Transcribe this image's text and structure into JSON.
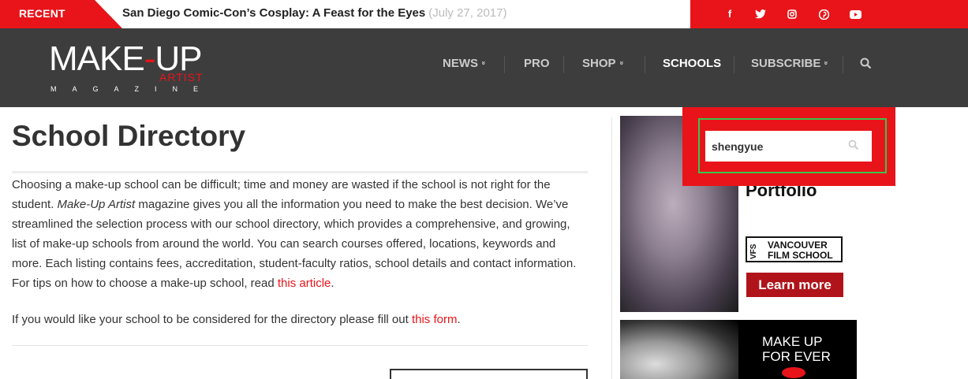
{
  "topbar": {
    "recent_label": "RECENT",
    "headline": "San Diego Comic-Con’s Cosplay: A Feast for the Eyes",
    "headline_date": "(July 27, 2017)",
    "social": [
      "facebook-icon",
      "twitter-icon",
      "instagram-icon",
      "pinterest-icon",
      "youtube-icon"
    ]
  },
  "logo": {
    "main_left": "MAKE",
    "main_dash": "-",
    "main_right": "UP",
    "sub": "ARTIST",
    "magazine": "MAGAZINE"
  },
  "nav": {
    "items": [
      {
        "label": "NEWS",
        "dropdown": true
      },
      {
        "label": "PRO",
        "dropdown": false
      },
      {
        "label": "SHOP",
        "dropdown": true
      },
      {
        "label": "SCHOOLS",
        "dropdown": false,
        "active": true
      },
      {
        "label": "SUBSCRIBE",
        "dropdown": true
      }
    ],
    "chevron": "»"
  },
  "page": {
    "title": "School Directory",
    "intro_1": "Choosing a make-up school can be difficult; time and money are wasted if the school is not right for the student.",
    "intro_italic": "Make-Up Artist",
    "intro_2": "magazine gives you all the information you need to make the best decision. We’ve streamlined the selection process with our school directory, which provides a comprehensive, and growing, list of make-up schools from around the world. You can search courses offered, locations, keywords and more. Each listing contains fees, accreditation, student-faculty ratios, school details and contact information. For tips on how to choose a make-up school, read",
    "intro_link": "this article",
    "intro_end": ".",
    "para2": "If you would like your school to be considered for the directory please fill out",
    "para2_link": "this form",
    "para2_end": "."
  },
  "ads": {
    "ad1_title": "Portfolio",
    "ad1_vfs_mark": "VFS",
    "ad1_vfs_line1": "VANCOUVER",
    "ad1_vfs_line2": "FILM SCHOOL",
    "ad1_button": "Learn more",
    "ad2_line1": "MAKE UP",
    "ad2_line2": "FOR EVER"
  },
  "search": {
    "value": "shengyue"
  },
  "colors": {
    "brand_red": "#e8141a",
    "nav_bg": "#3d3d3d",
    "focus_green": "#3bc44b"
  }
}
